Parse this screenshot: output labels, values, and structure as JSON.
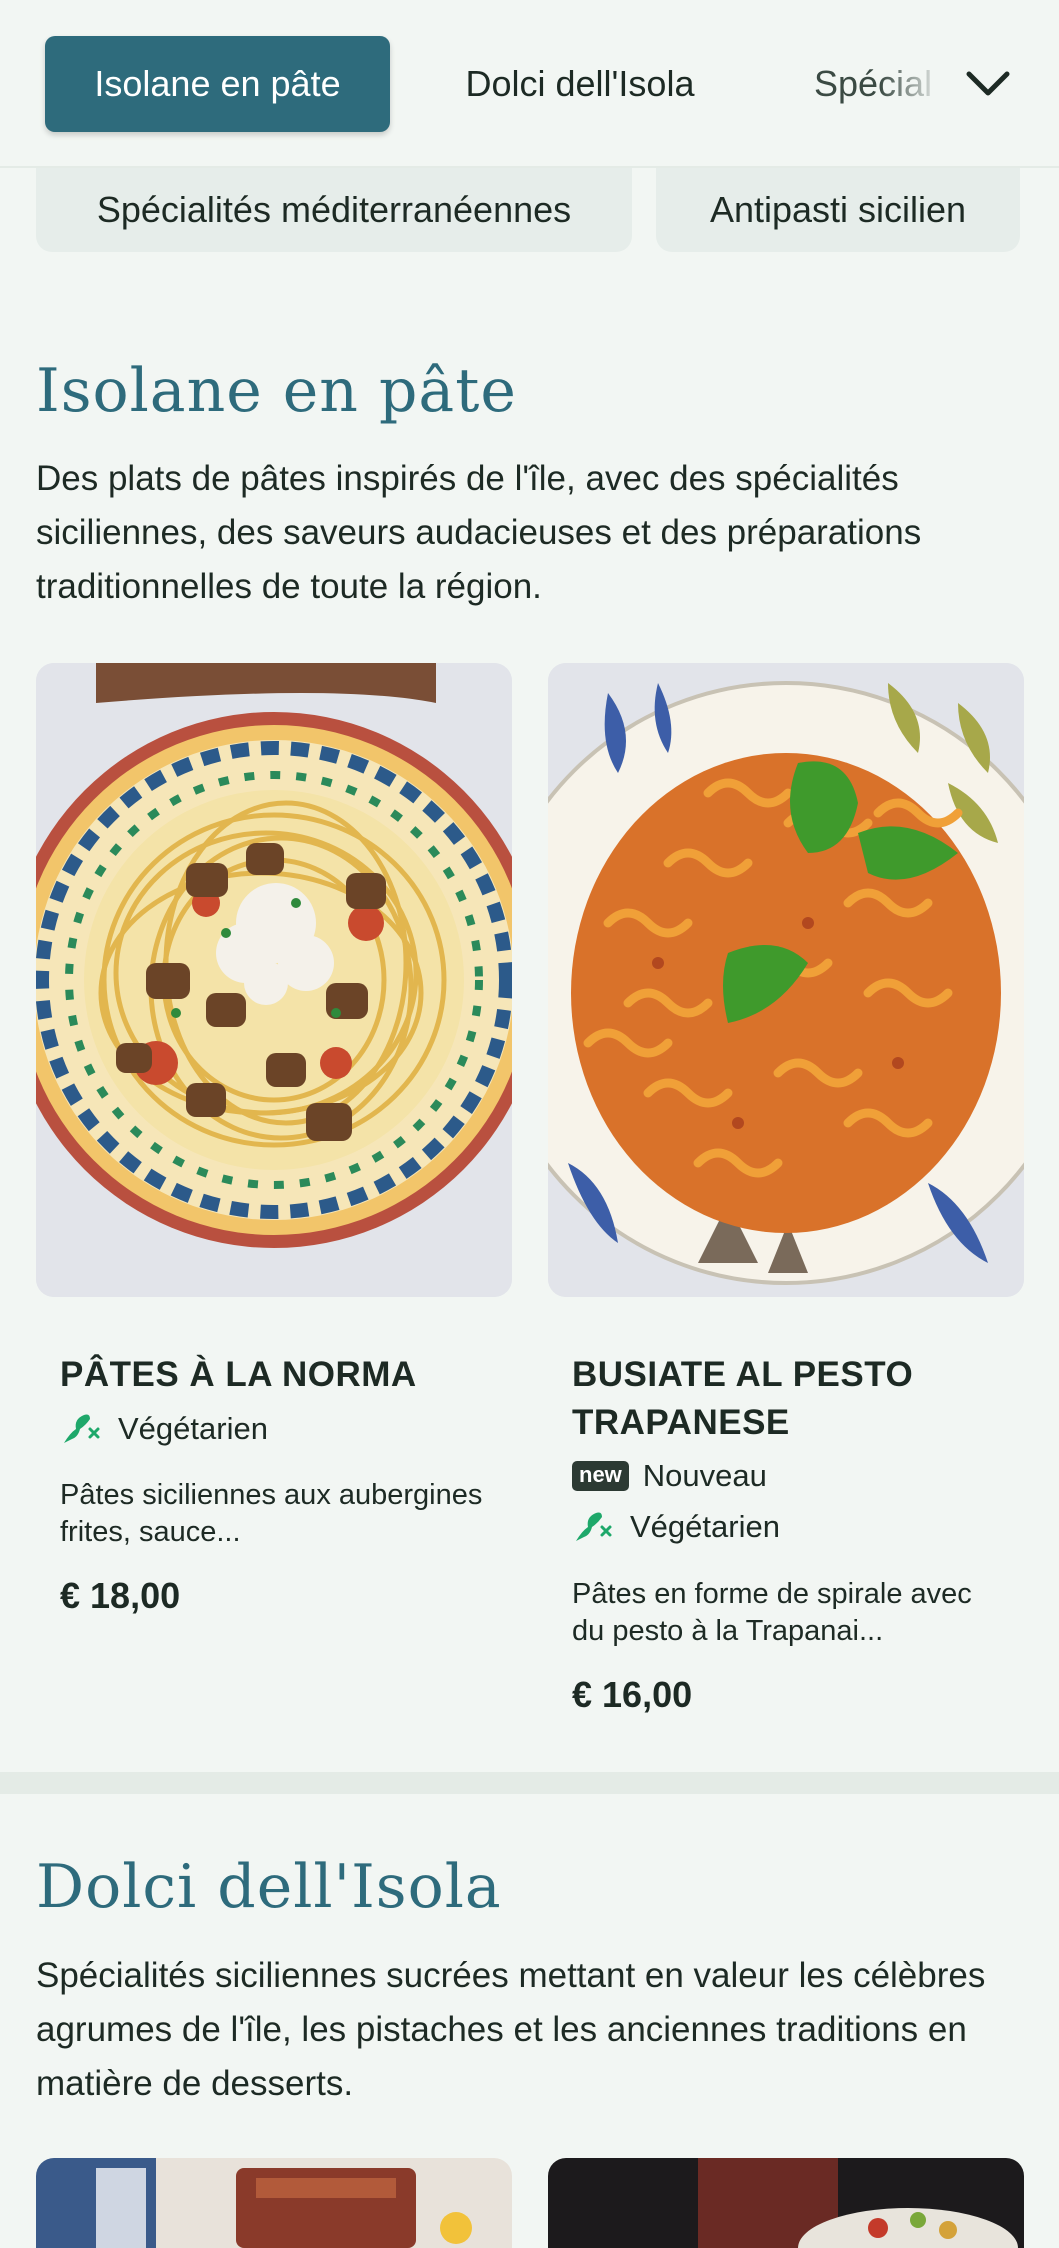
{
  "nav": {
    "tabs": [
      "Isolane en pâte",
      "Dolci dell'Isola",
      "Spécial"
    ],
    "active_index": 0,
    "expand_icon": "chevron-down-icon"
  },
  "chips": [
    "Spécialités méditerranéennes",
    "Antipasti sicilien"
  ],
  "sections": [
    {
      "title": "Isolane en pâte",
      "description": "Des plats de pâtes inspirés de l'île, avec des spécialités siciliennes, des saveurs audacieuses et des préparations traditionnelles de toute la région.",
      "items": [
        {
          "name": "PÂTES À LA NORMA",
          "badges": [
            {
              "icon": "vegetarian-icon",
              "label": "Végétarien"
            }
          ],
          "description": "Pâtes siciliennes aux aubergines frites, sauce...",
          "price": "€ 18,00"
        },
        {
          "name": "BUSIATE AL PESTO TRAPANESE",
          "badges": [
            {
              "icon": "new-badge",
              "badge_text": "new",
              "label": "Nouveau"
            },
            {
              "icon": "vegetarian-icon",
              "label": "Végétarien"
            }
          ],
          "description": "Pâtes en forme de spirale avec du pesto à la Trapanai...",
          "price": "€ 16,00"
        }
      ]
    },
    {
      "title": "Dolci dell'Isola",
      "description": "Spécialités siciliennes sucrées mettant en valeur les célèbres agrumes de l'île, les pistaches et les anciennes traditions en matière de desserts."
    }
  ],
  "colors": {
    "accent": "#2e6b7c",
    "background": "#f2f6f3",
    "vegetarian": "#1ea86a"
  }
}
